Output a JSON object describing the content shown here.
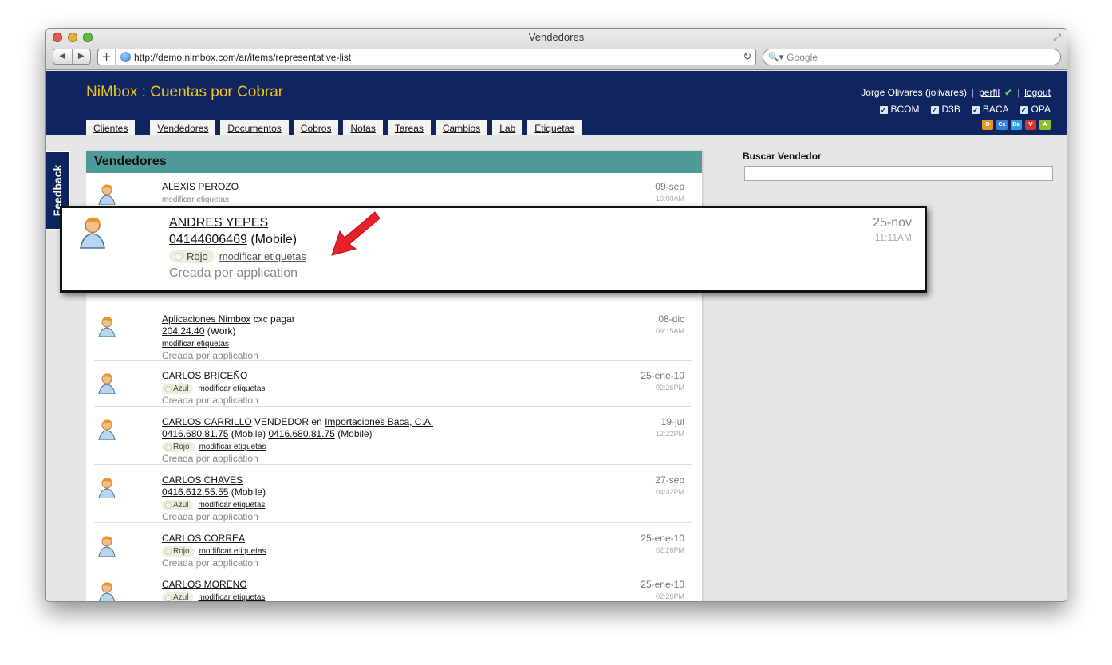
{
  "window": {
    "title": "Vendedores"
  },
  "browser": {
    "url": "http://demo.nimbox.com/ar/items/representative-list",
    "search_placeholder": "Google"
  },
  "header": {
    "app_title": "NiMbox : Cuentas por Cobrar",
    "user": "Jorge Olivares (jolivares)",
    "perfil": "perfil",
    "logout": "logout",
    "companies": [
      "BCOM",
      "D3B",
      "BACA",
      "OPA"
    ],
    "mini_icons": [
      {
        "label": "D",
        "color": "#f0961e"
      },
      {
        "label": "Cc",
        "color": "#3a7fd6"
      },
      {
        "label": "Be",
        "color": "#2aa4e0"
      },
      {
        "label": "V",
        "color": "#d8342f"
      },
      {
        "label": "A",
        "color": "#8fbf2a"
      }
    ],
    "tabs": [
      "Clientes",
      "Vendedores",
      "Documentos",
      "Cobros",
      "Notas",
      "Tareas",
      "Cambios",
      "Lab",
      "Etiquetas"
    ]
  },
  "feedback": "Feedback",
  "panel": {
    "title": "Vendedores",
    "edit_label": "modificar etiquetas",
    "created_by": "Creada por application",
    "rows": [
      {
        "name": "ALEXIS PEROZO",
        "date": "09-sep",
        "time": "10:00AM"
      },
      {
        "name": "Aplicaciones Nimbox",
        "name_suffix": " cxc pagar",
        "phone": "204.24.40",
        "phone_type": " (Work)",
        "date": "08-dic",
        "time": "09:15AM"
      },
      {
        "name": "CARLOS BRICEÑO",
        "tag": "Azul",
        "date": "25-ene-10",
        "time": "02:26PM"
      },
      {
        "name": "CARLOS CARRILLO",
        "name_suffix": " VENDEDOR en ",
        "company": "Importaciones Baca, C.A.",
        "phone": "0416.680.81.75",
        "phone_type": " (Mobile) ",
        "phone2": "0416.680.81.75",
        "phone2_type": " (Mobile)",
        "tag": "Rojo",
        "date": "19-jul",
        "time": "12:22PM"
      },
      {
        "name": "CARLOS CHAVES",
        "phone": "0416.612.55.55",
        "phone_type": " (Mobile)",
        "tag": "Azul",
        "date": "27-sep",
        "time": "04:32PM"
      },
      {
        "name": "CARLOS CORREA",
        "tag": "Rojo",
        "date": "25-ene-10",
        "time": "02:26PM"
      },
      {
        "name": "CARLOS MORENO",
        "tag": "Azul",
        "date": "25-ene-10",
        "time": "02:26PM"
      }
    ]
  },
  "zoom": {
    "name": "ANDRES YEPES",
    "phone": "04144606469",
    "phone_type": " (Mobile)",
    "tag": "Rojo",
    "edit_label": "modificar etiquetas",
    "created_by": "Creada por application",
    "date": "25-nov",
    "time": "11:11AM"
  },
  "search": {
    "label": "Buscar Vendedor"
  },
  "colors": {
    "header_bg": "#0f2560",
    "title_color": "#f3c21b",
    "panel_header": "#4e9a97",
    "arrow": "#e8202a"
  }
}
